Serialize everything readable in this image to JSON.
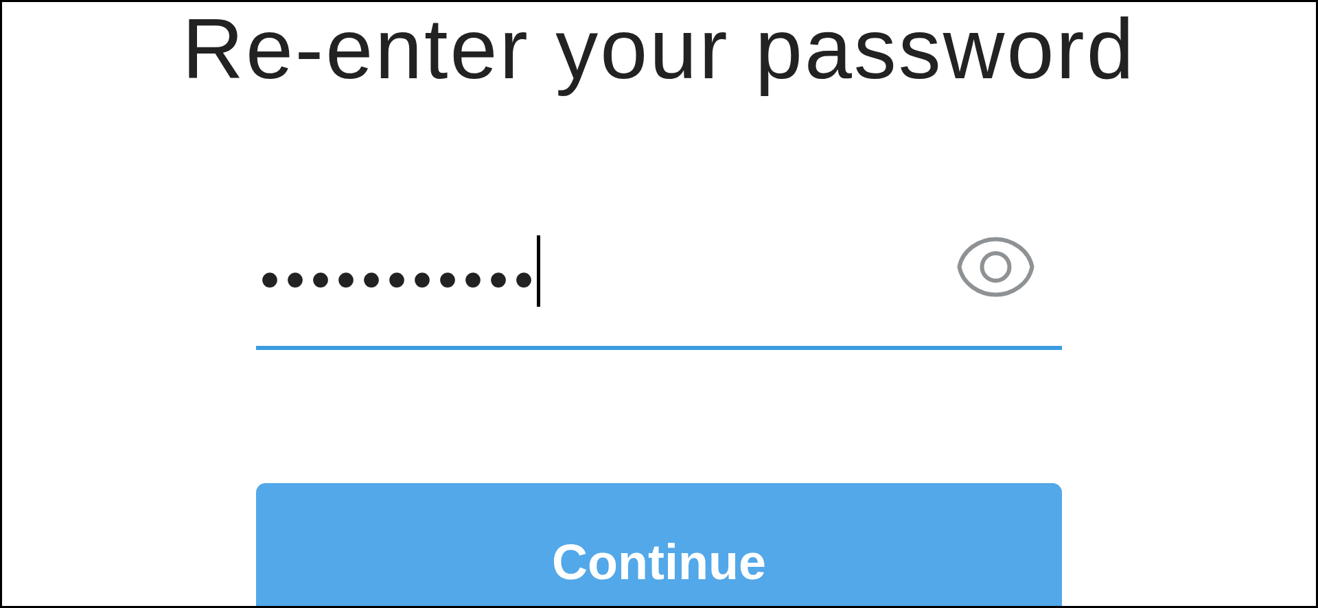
{
  "title": "Re-enter your password",
  "password_field": {
    "value": "•••••••••••",
    "focused": true
  },
  "continue_button": {
    "label": "Continue"
  }
}
